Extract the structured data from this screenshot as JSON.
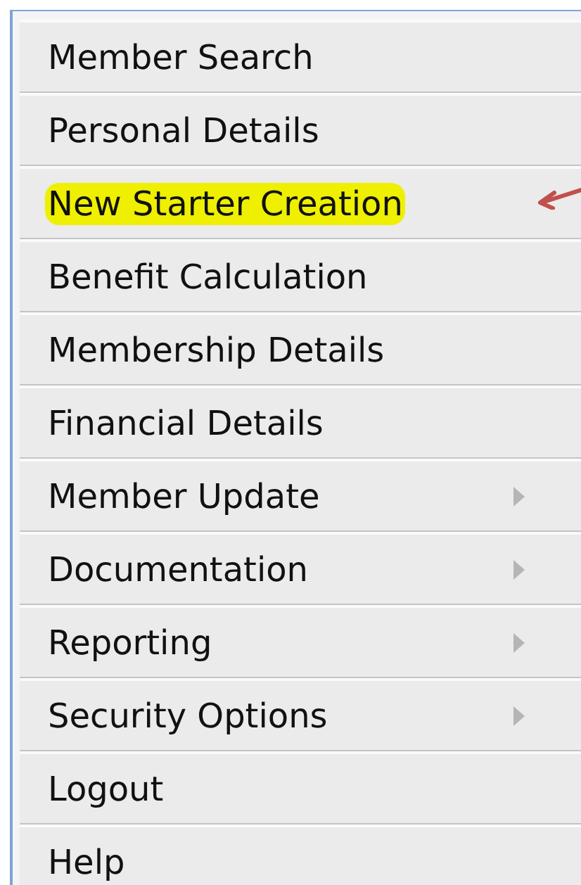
{
  "menu": {
    "items": [
      {
        "label": "Member Search",
        "highlighted": false,
        "has_submenu": false,
        "annotated": false
      },
      {
        "label": "Personal Details",
        "highlighted": false,
        "has_submenu": false,
        "annotated": false
      },
      {
        "label": "New Starter Creation",
        "highlighted": true,
        "has_submenu": false,
        "annotated": true
      },
      {
        "label": "Benefit Calculation",
        "highlighted": false,
        "has_submenu": false,
        "annotated": false
      },
      {
        "label": "Membership Details",
        "highlighted": false,
        "has_submenu": false,
        "annotated": false
      },
      {
        "label": "Financial Details",
        "highlighted": false,
        "has_submenu": false,
        "annotated": false
      },
      {
        "label": "Member Update",
        "highlighted": false,
        "has_submenu": true,
        "annotated": false
      },
      {
        "label": "Documentation",
        "highlighted": false,
        "has_submenu": true,
        "annotated": false
      },
      {
        "label": "Reporting",
        "highlighted": false,
        "has_submenu": true,
        "annotated": false
      },
      {
        "label": "Security Options",
        "highlighted": false,
        "has_submenu": true,
        "annotated": false
      },
      {
        "label": "Logout",
        "highlighted": false,
        "has_submenu": false,
        "annotated": false
      },
      {
        "label": "Help",
        "highlighted": false,
        "has_submenu": false,
        "annotated": false
      }
    ]
  }
}
